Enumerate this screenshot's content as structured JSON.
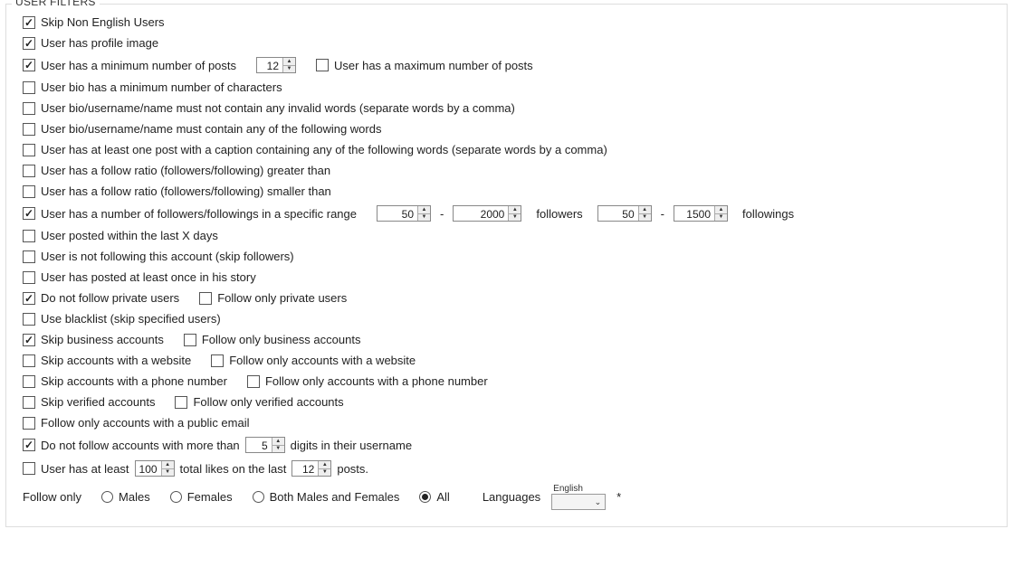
{
  "legend": "USER FILTERS",
  "filters": {
    "skip_non_english": "Skip Non English Users",
    "profile_image": "User has profile image",
    "min_posts": "User has a minimum number of posts",
    "min_posts_val": "12",
    "max_posts": "User has a maximum number of posts",
    "bio_min_chars": "User bio has a minimum number of characters",
    "bio_no_invalid": "User bio/username/name must not contain any invalid words (separate words by a comma)",
    "bio_contain": "User bio/username/name must contain any of the following words",
    "caption_words": "User has at least one post with a caption containing any of the following words (separate words by a comma)",
    "ratio_gt": "User has a follow ratio (followers/following) greater than",
    "ratio_lt": "User has a follow ratio (followers/following) smaller than",
    "range": "User has a number of followers/followings in a specific range",
    "followers_min": "50",
    "followers_max": "2000",
    "followers_label": "followers",
    "followings_min": "50",
    "followings_max": "1500",
    "followings_label": "followings",
    "posted_xdays": "User posted within the last X days",
    "not_following": "User is not following this account (skip followers)",
    "posted_story": "User has posted at least once in his story",
    "no_private": "Do not follow private users",
    "only_private": "Follow only private users",
    "blacklist": "Use blacklist (skip specified users)",
    "skip_business": "Skip business accounts",
    "only_business": "Follow only business accounts",
    "skip_website": "Skip accounts with a website",
    "only_website": "Follow only accounts with a website",
    "skip_phone": "Skip accounts with a phone number",
    "only_phone": "Follow only accounts with a phone number",
    "skip_verified": "Skip verified accounts",
    "only_verified": "Follow only verified accounts",
    "only_email": "Follow only accounts with a public email",
    "no_digits_a": "Do not follow accounts with more than",
    "no_digits_val": "5",
    "no_digits_b": "digits in their username",
    "likes_a": "User has at least",
    "likes_val": "100",
    "likes_b": "total likes on the last",
    "likes_posts_val": "12",
    "likes_c": "posts."
  },
  "gender": {
    "label": "Follow only",
    "males": "Males",
    "females": "Females",
    "both": "Both Males and Females",
    "all": "All"
  },
  "lang": {
    "label": "Languages",
    "small": "English",
    "asterisk": "*"
  },
  "sep": "-"
}
